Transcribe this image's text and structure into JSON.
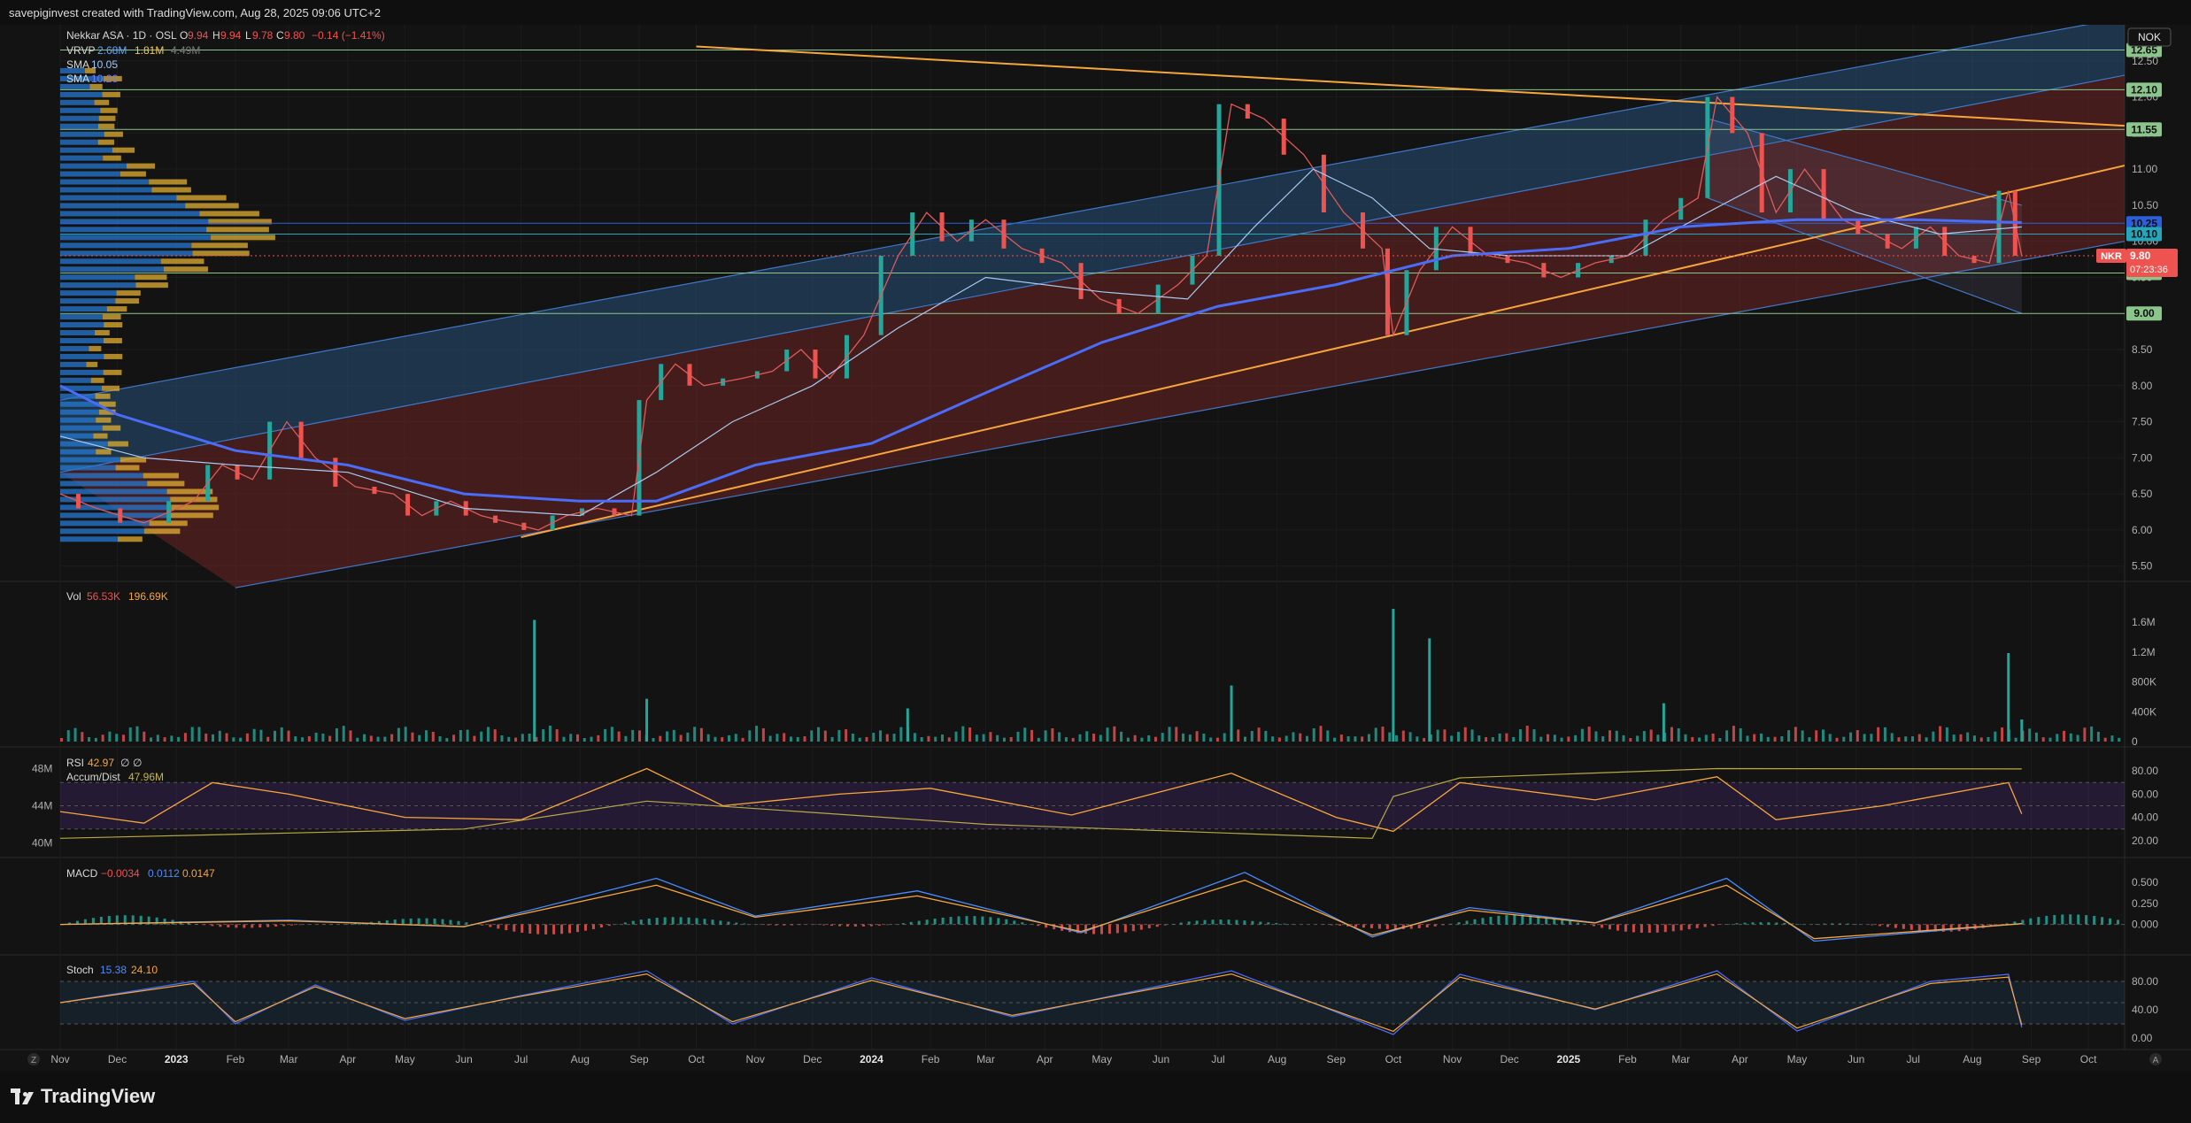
{
  "header": {
    "attribution": "savepiginvest created with TradingView.com, Aug 28, 2025 09:06 UTC+2"
  },
  "legend": {
    "symbol": "Nekkar ASA · 1D · OSL",
    "ohlc": [
      {
        "label": "O",
        "value": "9.94"
      },
      {
        "label": "H",
        "value": "9.94"
      },
      {
        "label": "L",
        "value": "9.78"
      },
      {
        "label": "C",
        "value": "9.80"
      }
    ],
    "change": "−0.14 (−1.41%)",
    "vrvp": {
      "label": "VRVP",
      "v1": "2.68M",
      "v2": "1.81M",
      "v3": "4.49M"
    },
    "sma1": {
      "label": "SMA",
      "value": "10.05"
    },
    "sma2": {
      "label": "SMA",
      "value": "10.26"
    }
  },
  "currency": "NOK",
  "ticker_tag": {
    "symbol": "NKR",
    "price": "9.80",
    "countdown": "07:23:36"
  },
  "price_tags": [
    {
      "value": "12.65",
      "color": "#8bc58b"
    },
    {
      "value": "12.10",
      "color": "#8bc58b"
    },
    {
      "value": "11.55",
      "color": "#8bc58b"
    },
    {
      "value": "10.25",
      "color": "#2c5fd9"
    },
    {
      "value": "10.10",
      "color": "#26a6b8"
    },
    {
      "value": "9.56",
      "color": "#8bc58b"
    },
    {
      "value": "9.00",
      "color": "#8bc58b"
    }
  ],
  "panes": {
    "volume": {
      "label": "Vol",
      "v1": "56.53K",
      "v2": "196.69K"
    },
    "rsi": {
      "label": "RSI",
      "v1": "42.97",
      "v2": "∅",
      "v3": "∅",
      "accum_label": "Accum/Dist",
      "accum_value": "47.96M"
    },
    "macd": {
      "label": "MACD",
      "v1": "−0.0034",
      "v2": "0.0112",
      "v3": "0.0147"
    },
    "stoch": {
      "label": "Stoch",
      "v1": "15.38",
      "v2": "24.10"
    }
  },
  "time_axis": [
    "Nov",
    "Dec",
    "2023",
    "Feb",
    "Mar",
    "Apr",
    "May",
    "Jun",
    "Jul",
    "Aug",
    "Sep",
    "Oct",
    "Nov",
    "Dec",
    "2024",
    "Feb",
    "Mar",
    "Apr",
    "May",
    "Jun",
    "Jul",
    "Aug",
    "Sep",
    "Oct",
    "Nov",
    "Dec",
    "2025",
    "Feb",
    "Mar",
    "Apr",
    "May",
    "Jun",
    "Jul",
    "Aug",
    "Sep",
    "Oct"
  ],
  "brand": "TradingView",
  "colors": {
    "up": "#26a69a",
    "down": "#ef5350",
    "orange": "#f7a63b",
    "sma_blue": "#4a6cf7",
    "channel_blue": "#2a5d8f",
    "channel_red": "#6e2525"
  },
  "chart_data": {
    "type": "line",
    "title": "",
    "x_start": "2022-11-01",
    "x_end": "2025-10-20",
    "price_axis": {
      "ticks": [
        5.5,
        6.0,
        6.5,
        7.0,
        7.5,
        8.0,
        8.5,
        9.0,
        9.5,
        10.0,
        10.5,
        11.0,
        11.5,
        12.0,
        12.5
      ],
      "ylim": [
        5.3,
        13.0
      ]
    },
    "price_series": {
      "name": "",
      "points": [
        [
          "2022-11-01",
          6.5
        ],
        [
          "2022-11-20",
          6.3
        ],
        [
          "2022-12-15",
          6.1
        ],
        [
          "2023-01-10",
          6.4
        ],
        [
          "2023-01-25",
          6.9
        ],
        [
          "2023-02-10",
          6.7
        ],
        [
          "2023-02-28",
          7.5
        ],
        [
          "2023-03-15",
          7.0
        ],
        [
          "2023-04-05",
          6.6
        ],
        [
          "2023-04-25",
          6.5
        ],
        [
          "2023-05-10",
          6.2
        ],
        [
          "2023-05-25",
          6.4
        ],
        [
          "2023-06-10",
          6.2
        ],
        [
          "2023-06-25",
          6.1
        ],
        [
          "2023-07-10",
          6.0
        ],
        [
          "2023-07-25",
          6.2
        ],
        [
          "2023-08-10",
          6.3
        ],
        [
          "2023-08-28",
          6.2
        ],
        [
          "2023-09-05",
          7.8
        ],
        [
          "2023-09-20",
          8.3
        ],
        [
          "2023-10-05",
          8.0
        ],
        [
          "2023-10-25",
          8.1
        ],
        [
          "2023-11-10",
          8.2
        ],
        [
          "2023-11-25",
          8.5
        ],
        [
          "2023-12-10",
          8.1
        ],
        [
          "2023-12-28",
          8.7
        ],
        [
          "2024-01-15",
          9.8
        ],
        [
          "2024-01-30",
          10.4
        ],
        [
          "2024-02-15",
          10.0
        ],
        [
          "2024-03-01",
          10.3
        ],
        [
          "2024-03-20",
          9.9
        ],
        [
          "2024-04-10",
          9.7
        ],
        [
          "2024-04-30",
          9.2
        ],
        [
          "2024-05-20",
          9.0
        ],
        [
          "2024-06-10",
          9.4
        ],
        [
          "2024-06-25",
          9.8
        ],
        [
          "2024-07-08",
          11.9
        ],
        [
          "2024-07-25",
          11.7
        ],
        [
          "2024-08-15",
          11.2
        ],
        [
          "2024-09-05",
          10.4
        ],
        [
          "2024-09-25",
          9.9
        ],
        [
          "2024-10-01",
          8.7
        ],
        [
          "2024-10-15",
          9.6
        ],
        [
          "2024-11-01",
          10.2
        ],
        [
          "2024-11-20",
          9.8
        ],
        [
          "2024-12-10",
          9.7
        ],
        [
          "2024-12-28",
          9.5
        ],
        [
          "2025-01-15",
          9.7
        ],
        [
          "2025-02-01",
          9.8
        ],
        [
          "2025-02-20",
          10.3
        ],
        [
          "2025-03-10",
          10.6
        ],
        [
          "2025-03-20",
          12.0
        ],
        [
          "2025-04-05",
          11.5
        ],
        [
          "2025-04-20",
          10.4
        ],
        [
          "2025-05-05",
          11.0
        ],
        [
          "2025-05-25",
          10.3
        ],
        [
          "2025-06-10",
          10.1
        ],
        [
          "2025-06-25",
          9.9
        ],
        [
          "2025-07-10",
          10.2
        ],
        [
          "2025-07-25",
          9.8
        ],
        [
          "2025-08-10",
          9.7
        ],
        [
          "2025-08-20",
          10.7
        ],
        [
          "2025-08-27",
          9.8
        ]
      ]
    },
    "sma_fast": {
      "name": "",
      "points": [
        [
          "2022-11-01",
          7.3
        ],
        [
          "2022-12-15",
          7.0
        ],
        [
          "2023-02-01",
          6.9
        ],
        [
          "2023-04-01",
          6.8
        ],
        [
          "2023-06-01",
          6.3
        ],
        [
          "2023-08-01",
          6.2
        ],
        [
          "2023-09-10",
          6.8
        ],
        [
          "2023-10-20",
          7.5
        ],
        [
          "2023-12-01",
          8.0
        ],
        [
          "2024-01-15",
          8.8
        ],
        [
          "2024-03-01",
          9.5
        ],
        [
          "2024-05-01",
          9.3
        ],
        [
          "2024-06-15",
          9.2
        ],
        [
          "2024-07-20",
          10.2
        ],
        [
          "2024-08-20",
          11.0
        ],
        [
          "2024-09-20",
          10.6
        ],
        [
          "2024-10-20",
          9.9
        ],
        [
          "2024-12-01",
          9.8
        ],
        [
          "2025-02-01",
          9.8
        ],
        [
          "2025-03-15",
          10.4
        ],
        [
          "2025-04-20",
          10.9
        ],
        [
          "2025-06-01",
          10.4
        ],
        [
          "2025-07-15",
          10.1
        ],
        [
          "2025-08-27",
          10.2
        ]
      ]
    },
    "sma_slow": {
      "name": "",
      "points": [
        [
          "2022-11-01",
          8.0
        ],
        [
          "2022-12-01",
          7.6
        ],
        [
          "2023-02-01",
          7.1
        ],
        [
          "2023-04-01",
          6.9
        ],
        [
          "2023-06-01",
          6.5
        ],
        [
          "2023-08-01",
          6.4
        ],
        [
          "2023-09-10",
          6.4
        ],
        [
          "2023-11-01",
          6.9
        ],
        [
          "2024-01-01",
          7.2
        ],
        [
          "2024-03-01",
          7.9
        ],
        [
          "2024-05-01",
          8.6
        ],
        [
          "2024-07-01",
          9.1
        ],
        [
          "2024-09-01",
          9.4
        ],
        [
          "2024-11-01",
          9.8
        ],
        [
          "2025-01-01",
          9.9
        ],
        [
          "2025-03-01",
          10.2
        ],
        [
          "2025-05-01",
          10.3
        ],
        [
          "2025-07-01",
          10.3
        ],
        [
          "2025-08-27",
          10.26
        ]
      ]
    },
    "channels": {
      "blue_upper": [
        [
          "2022-11-01",
          7.8
        ],
        [
          "2025-10-20",
          13.1
        ]
      ],
      "blue_lower": [
        [
          "2023-02-01",
          5.3
        ],
        [
          "2025-10-20",
          10.8
        ]
      ],
      "red_upper": [
        [
          "2022-11-01",
          6.8
        ],
        [
          "2025-10-20",
          12.3
        ]
      ],
      "red_lower": [
        [
          "2023-02-01",
          5.2
        ],
        [
          "2025-10-20",
          10.0
        ]
      ],
      "down_channel_upper": [
        [
          "2025-03-15",
          11.7
        ],
        [
          "2025-08-27",
          10.5
        ]
      ],
      "down_channel_lower": [
        [
          "2025-03-15",
          10.6
        ],
        [
          "2025-08-27",
          9.0
        ]
      ]
    },
    "trendlines": {
      "resistance": [
        [
          "2023-10-01",
          12.7
        ],
        [
          "2025-10-20",
          11.6
        ]
      ],
      "support": [
        [
          "2023-07-01",
          5.9
        ],
        [
          "2025-10-20",
          11.05
        ]
      ]
    },
    "horizontal_levels": [
      12.65,
      12.1,
      11.55,
      10.25,
      10.1,
      9.56,
      9.0
    ],
    "volume_axis": {
      "ticks": [
        "0",
        "400K",
        "800K",
        "1.2M",
        "1.6M"
      ],
      "max": 1800000
    },
    "volume_spikes": [
      [
        "2023-07-08",
        1650000
      ],
      [
        "2023-09-05",
        580000
      ],
      [
        "2024-01-20",
        450000
      ],
      [
        "2024-07-08",
        760000
      ],
      [
        "2024-10-01",
        1800000
      ],
      [
        "2024-10-20",
        1400000
      ],
      [
        "2025-02-20",
        520000
      ],
      [
        "2025-08-20",
        1200000
      ],
      [
        "2025-08-27",
        300000
      ]
    ],
    "rsi_axis": {
      "ticks": [
        "20.00",
        "40.00",
        "60.00",
        "80.00"
      ]
    },
    "accum_axis": {
      "ticks": [
        "40M",
        "44M",
        "48M"
      ]
    },
    "rsi_series": {
      "name": "",
      "points": [
        [
          "2022-11-01",
          45
        ],
        [
          "2022-12-15",
          35
        ],
        [
          "2023-01-20",
          70
        ],
        [
          "2023-03-01",
          60
        ],
        [
          "2023-05-01",
          40
        ],
        [
          "2023-07-01",
          38
        ],
        [
          "2023-09-05",
          82
        ],
        [
          "2023-10-15",
          50
        ],
        [
          "2023-12-15",
          60
        ],
        [
          "2024-02-01",
          65
        ],
        [
          "2024-04-15",
          42
        ],
        [
          "2024-07-08",
          78
        ],
        [
          "2024-09-01",
          40
        ],
        [
          "2024-10-01",
          28
        ],
        [
          "2024-11-05",
          70
        ],
        [
          "2025-01-15",
          55
        ],
        [
          "2025-03-20",
          75
        ],
        [
          "2025-04-20",
          38
        ],
        [
          "2025-06-15",
          50
        ],
        [
          "2025-08-20",
          70
        ],
        [
          "2025-08-27",
          43
        ]
      ]
    },
    "accum_series": {
      "name": "",
      "points": [
        [
          "2022-11-01",
          40.5
        ],
        [
          "2023-06-01",
          41.5
        ],
        [
          "2023-09-05",
          44.5
        ],
        [
          "2024-03-01",
          42.0
        ],
        [
          "2024-09-20",
          40.5
        ],
        [
          "2024-10-01",
          45.0
        ],
        [
          "2024-11-05",
          47.0
        ],
        [
          "2025-03-20",
          48.0
        ],
        [
          "2025-08-27",
          47.96
        ]
      ]
    },
    "macd_axis": {
      "ticks": [
        "0.000",
        "0.250",
        "0.500"
      ]
    },
    "macd_series": {
      "name": "",
      "points": [
        [
          "2022-11-01",
          0.0
        ],
        [
          "2023-03-01",
          0.05
        ],
        [
          "2023-06-01",
          -0.03
        ],
        [
          "2023-09-10",
          0.55
        ],
        [
          "2023-11-01",
          0.1
        ],
        [
          "2024-01-25",
          0.4
        ],
        [
          "2024-04-20",
          -0.1
        ],
        [
          "2024-07-15",
          0.62
        ],
        [
          "2024-09-20",
          -0.15
        ],
        [
          "2024-11-10",
          0.2
        ],
        [
          "2025-01-15",
          0.02
        ],
        [
          "2025-03-25",
          0.55
        ],
        [
          "2025-05-10",
          -0.2
        ],
        [
          "2025-08-27",
          0.01
        ]
      ]
    },
    "stoch_axis": {
      "ticks": [
        "0.00",
        "40.00",
        "80.00"
      ]
    },
    "stoch_series": {
      "name": "",
      "points": [
        [
          "2022-11-01",
          50
        ],
        [
          "2023-01-10",
          80
        ],
        [
          "2023-02-01",
          20
        ],
        [
          "2023-03-15",
          75
        ],
        [
          "2023-05-01",
          25
        ],
        [
          "2023-07-01",
          60
        ],
        [
          "2023-09-05",
          95
        ],
        [
          "2023-10-20",
          20
        ],
        [
          "2024-01-01",
          85
        ],
        [
          "2024-03-15",
          30
        ],
        [
          "2024-07-08",
          95
        ],
        [
          "2024-10-01",
          5
        ],
        [
          "2024-11-05",
          90
        ],
        [
          "2025-01-15",
          40
        ],
        [
          "2025-03-20",
          95
        ],
        [
          "2025-05-01",
          10
        ],
        [
          "2025-07-10",
          80
        ],
        [
          "2025-08-20",
          90
        ],
        [
          "2025-08-27",
          15
        ]
      ]
    }
  }
}
